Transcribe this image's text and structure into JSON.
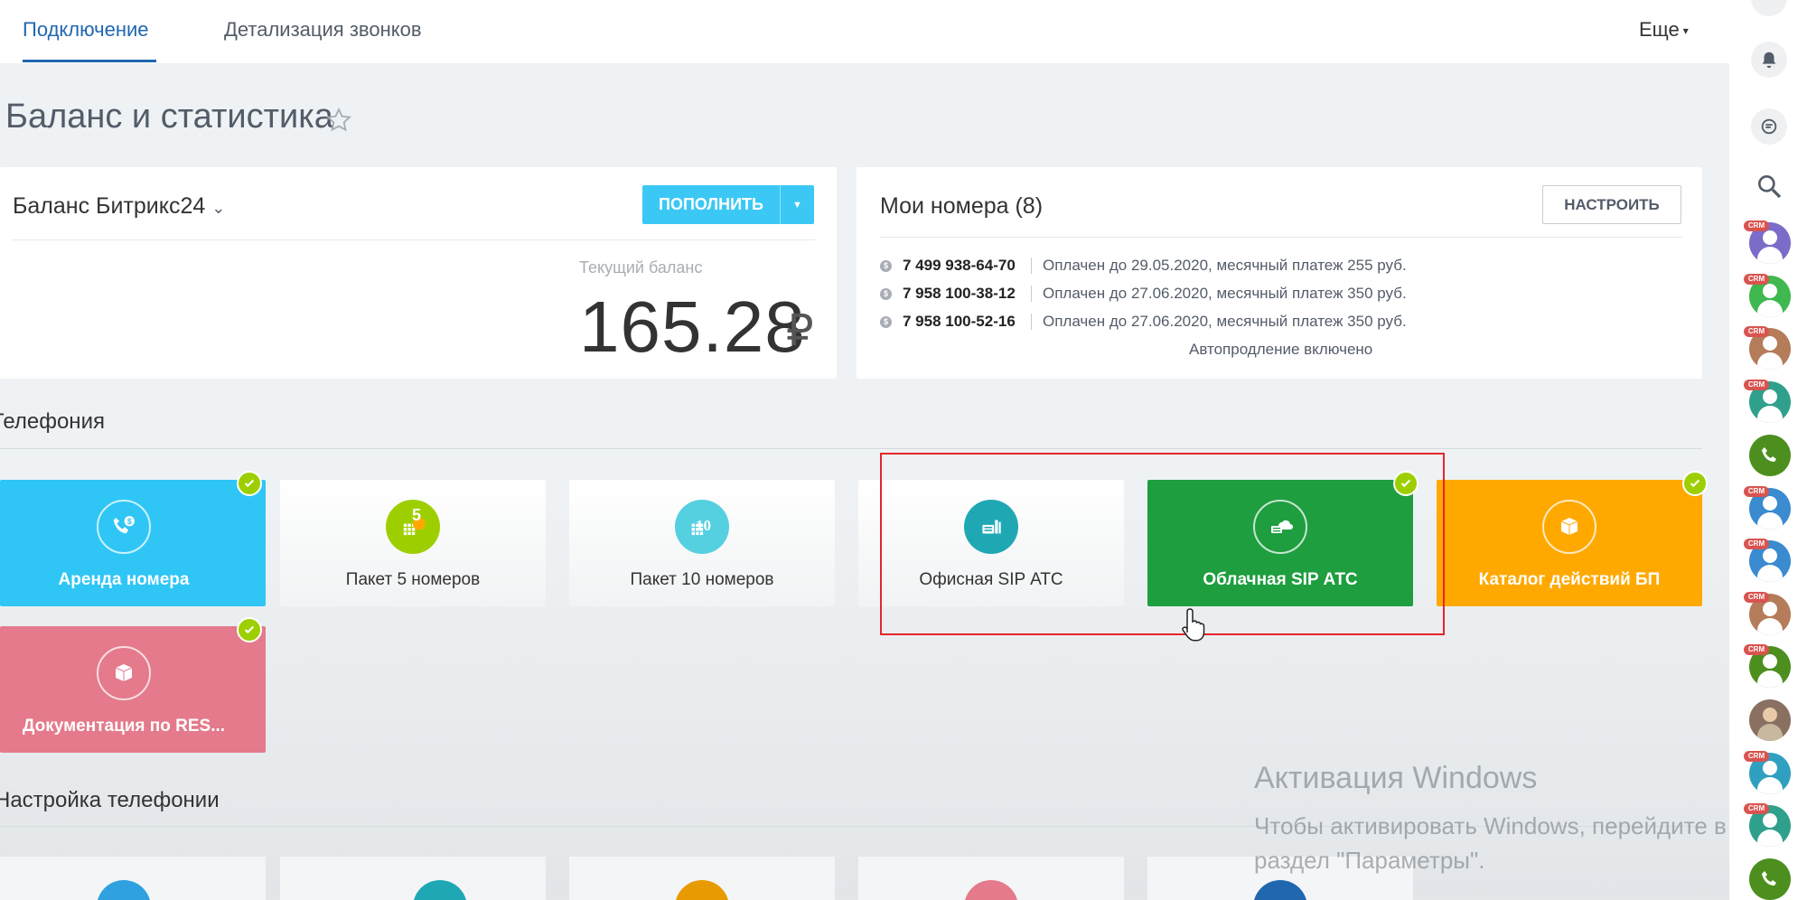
{
  "nav": {
    "tabs": [
      {
        "label": "Подключение",
        "active": true
      },
      {
        "label": "Детализация звонков",
        "active": false
      }
    ],
    "more_label": "Еще"
  },
  "page": {
    "title": "Баланс и статистика"
  },
  "balance": {
    "title": "Баланс Битрикс24",
    "topup_label": "ПОПОЛНИТЬ",
    "current_label": "Текущий баланс",
    "amount": "165.28",
    "currency": "₽"
  },
  "numbers": {
    "title": "Мои номера (8)",
    "setup_label": "НАСТРОИТЬ",
    "items": [
      {
        "phone": "7 499 938-64-70",
        "info": "Оплачен до 29.05.2020, месячный платеж 255 руб."
      },
      {
        "phone": "7 958 100-38-12",
        "info": "Оплачен до 27.06.2020, месячный платеж 350 руб."
      },
      {
        "phone": "7 958 100-52-16",
        "info": "Оплачен до 27.06.2020, месячный платеж 350 руб."
      }
    ],
    "autorenew": "Автопродление включено"
  },
  "telephony": {
    "title": "Телефония",
    "tiles": [
      {
        "label": "Аренда номера",
        "color": "#2fc6f6",
        "checked": true
      },
      {
        "label": "Пакет 5 номеров",
        "color": "#9dcf00",
        "badge": "5",
        "checked": false
      },
      {
        "label": "Пакет 10 номеров",
        "color": "#55d0e0",
        "badge": "10",
        "checked": false
      },
      {
        "label": "Офисная SIP АТС",
        "color": "#1fa8b4",
        "checked": false
      },
      {
        "label": "Облачная SIP АТС",
        "color": "#1e9e3f",
        "checked": true
      },
      {
        "label": "Каталог действий БП",
        "color": "#ffa900",
        "checked": true
      },
      {
        "label": "Документация по RES...",
        "color": "#e47a8b",
        "checked": true
      }
    ]
  },
  "telephony_settings": {
    "title": "Настройка телефонии"
  },
  "windows_activation": {
    "title": "Активация Windows",
    "text": "Чтобы активировать Windows, перейдите в раздел \"Параметры\"."
  },
  "sidebar": {
    "crm_badge": "CRM",
    "avatar_colors": [
      "#7b6cc9",
      "#3fb84f",
      "#b57c5a",
      "#2fa08c",
      "#4c8f1e",
      "#3a8bd0",
      "#3a8bd0",
      "#b57c5a",
      "#4c8f1e",
      "#8a7060",
      "#2fa0c0",
      "#2fa08c",
      "#4c8f1e"
    ]
  },
  "colors": {
    "accent": "#2067b0",
    "highlight": "#e8242c"
  }
}
